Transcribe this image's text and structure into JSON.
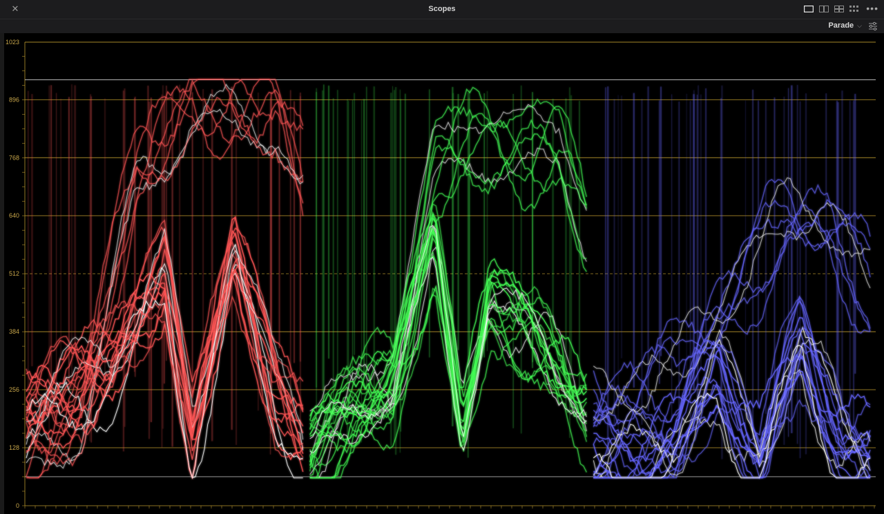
{
  "window": {
    "title": "Scopes",
    "close_icon": "close-icon",
    "layout_icons": [
      "single-view-icon",
      "dual-view-icon",
      "quad-view-icon",
      "multi-view-icon"
    ],
    "more_icon": "more-options-icon"
  },
  "toolbar": {
    "mode_label": "Parade",
    "mode_icon": "chevron-down-icon",
    "settings_icon": "settings-sliders-icon"
  },
  "scope": {
    "type": "rgb-parade-waveform",
    "y_axis_labels": [
      "1023",
      "896",
      "768",
      "640",
      "512",
      "384",
      "256",
      "128",
      "0"
    ],
    "y_range": [
      0,
      1023
    ],
    "colors": {
      "grid": "#b8962e",
      "labels": "#c8a64a",
      "red": "#ff5555",
      "green": "#44ff55",
      "blue": "#6666ff"
    },
    "channels": [
      "red",
      "green",
      "blue"
    ]
  }
}
